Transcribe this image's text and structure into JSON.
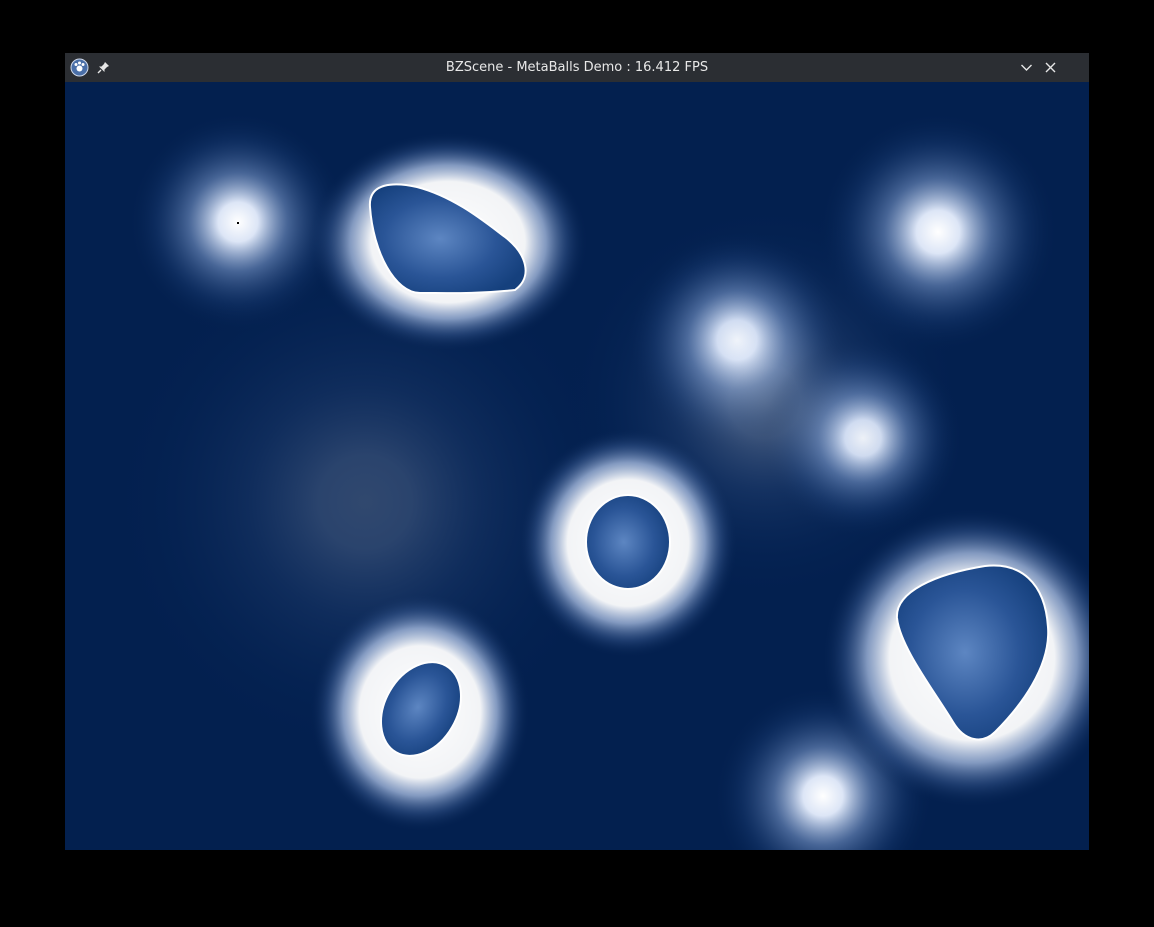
{
  "window": {
    "title": "BZScene - MetaBalls Demo : 16.412 FPS",
    "icons": {
      "app": "app-logo-icon",
      "pin": "pin-icon",
      "minimize": "chevron-down-icon",
      "close": "close-icon"
    }
  },
  "scene": {
    "background_color": "#03204f",
    "glow_color": "#ffffff",
    "blob_fill_color": "#1c4a8a",
    "blob_outline_color": "#ffffff"
  }
}
